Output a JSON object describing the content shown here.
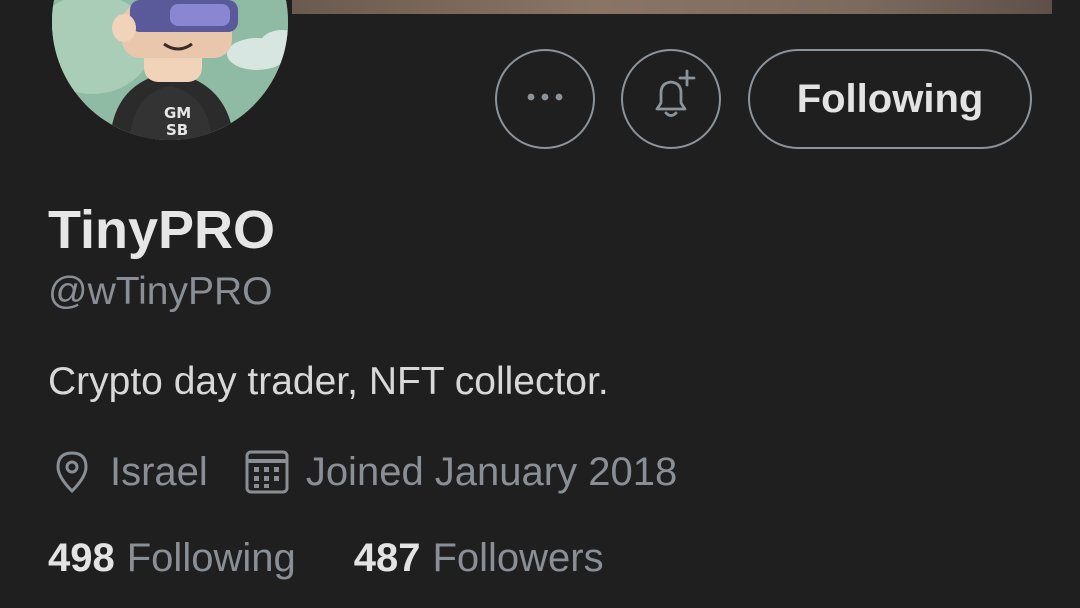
{
  "profile": {
    "display_name": "TinyPRO",
    "handle": "@wTinyPRO",
    "bio": "Crypto day trader, NFT collector.",
    "location": "Israel",
    "joined": "Joined January 2018",
    "avatar_text_top": "GM",
    "avatar_text_bottom": "SB"
  },
  "actions": {
    "follow_label": "Following",
    "more_icon": "more-icon",
    "notify_icon": "bell-plus-icon"
  },
  "stats": {
    "following_count": "498",
    "following_label": "Following",
    "followers_count": "487",
    "followers_label": "Followers"
  },
  "colors": {
    "background": "#1f1f1f",
    "text_primary": "#e6e6e6",
    "text_secondary": "#8a8f95",
    "border": "#8c9399"
  }
}
